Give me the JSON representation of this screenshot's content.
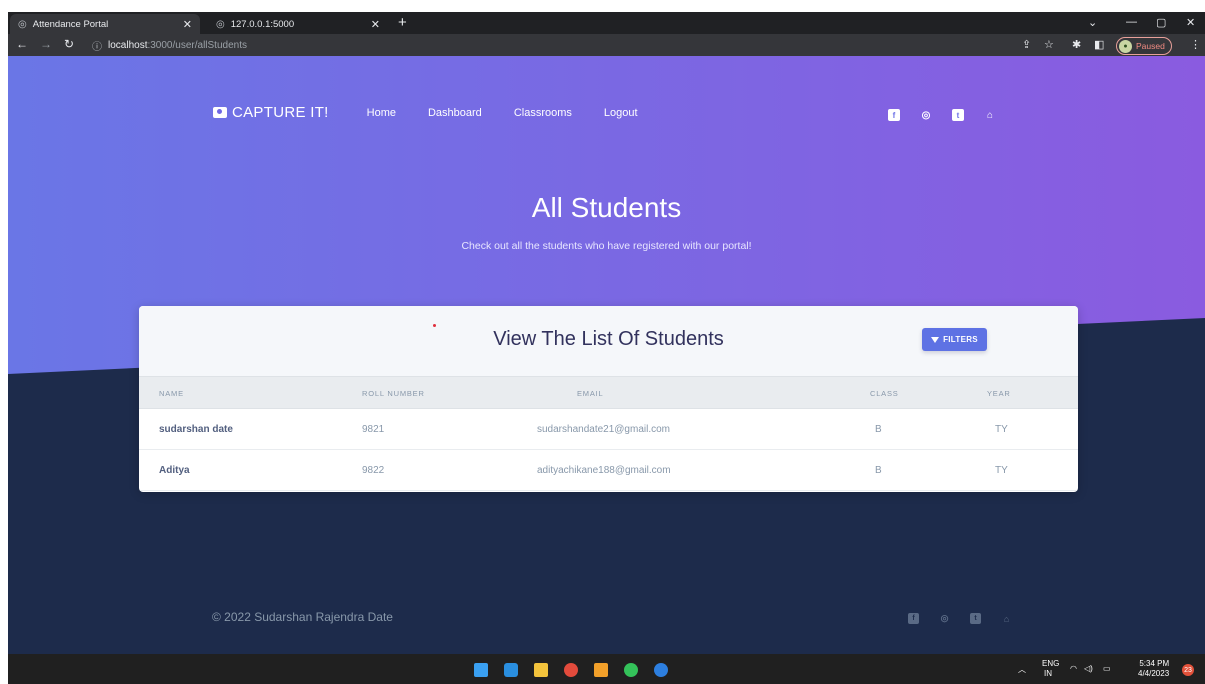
{
  "browser": {
    "tabs": [
      {
        "title": "Attendance Portal"
      },
      {
        "title": "127.0.0.1:5000"
      }
    ],
    "new_tab_label": "+",
    "url_host": "localhost",
    "url_path": ":3000/user/allStudents",
    "profile_status": "Paused"
  },
  "navbar": {
    "brand": "CAPTURE IT!",
    "links": [
      "Home",
      "Dashboard",
      "Classrooms",
      "Logout"
    ],
    "social_icons": [
      "facebook-icon",
      "instagram-icon",
      "twitter-icon",
      "github-icon"
    ]
  },
  "hero": {
    "title": "All Students",
    "subtitle": "Check out all the students who have registered with our portal!"
  },
  "card": {
    "title": "View The List Of Students",
    "filters_label": "FILTERS",
    "columns": [
      "NAME",
      "ROLL NUMBER",
      "EMAIL",
      "CLASS",
      "YEAR"
    ],
    "rows": [
      {
        "name": "sudarshan date",
        "roll": "9821",
        "email": "sudarshandate21@gmail.com",
        "class": "B",
        "year": "TY"
      },
      {
        "name": "Aditya",
        "roll": "9822",
        "email": "adityachikane188@gmail.com",
        "class": "B",
        "year": "TY"
      }
    ]
  },
  "footer": {
    "copyright": "© 2022 Sudarshan Rajendra Date"
  },
  "taskbar": {
    "lang_top": "ENG",
    "lang_bottom": "IN",
    "time": "5:34 PM",
    "date": "4/4/2023",
    "notification_count": "23"
  },
  "colors": {
    "hero_gradient_left": "#6a76e6",
    "hero_gradient_right": "#8a5be0",
    "page_dark": "#1d2b4b",
    "accent": "#5e72e4"
  }
}
